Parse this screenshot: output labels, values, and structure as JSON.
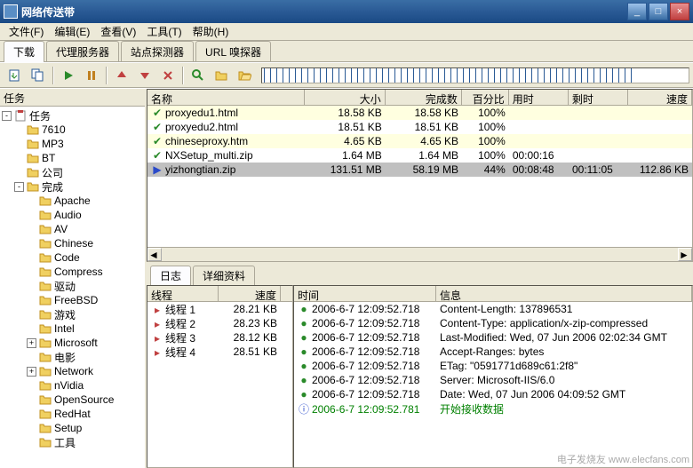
{
  "window": {
    "title": "网络传送带"
  },
  "menu": {
    "file": "文件(F)",
    "edit": "编辑(E)",
    "view": "查看(V)",
    "tools": "工具(T)",
    "help": "帮助(H)"
  },
  "tabs": {
    "download": "下载",
    "proxy": "代理服务器",
    "site_explorer": "站点探测器",
    "url_sniffer": "URL 嗅探器"
  },
  "tree_header": "任务",
  "tree": {
    "root": "任务",
    "items": [
      "7610",
      "MP3",
      "BT",
      "公司"
    ],
    "done": "完成",
    "done_items": [
      "Apache",
      "Audio",
      "AV",
      "Chinese",
      "Code",
      "Compress",
      "驱动",
      "FreeBSD",
      "游戏",
      "Intel",
      "Microsoft",
      "电影",
      "Network",
      "nVidia",
      "OpenSource",
      "RedHat",
      "Setup",
      "工具"
    ]
  },
  "columns": {
    "name": "名称",
    "size": "大小",
    "done": "完成数",
    "percent": "百分比",
    "time": "用时",
    "remain": "剩时",
    "speed": "速度"
  },
  "files": [
    {
      "status": "ok",
      "name": "proxyedu1.html",
      "size": "18.58 KB",
      "done": "18.58 KB",
      "pct": "100%",
      "time": "",
      "remain": "",
      "speed": ""
    },
    {
      "status": "ok",
      "name": "proxyedu2.html",
      "size": "18.51 KB",
      "done": "18.51 KB",
      "pct": "100%",
      "time": "",
      "remain": "",
      "speed": ""
    },
    {
      "status": "ok",
      "name": "chineseproxy.htm",
      "size": "4.65 KB",
      "done": "4.65 KB",
      "pct": "100%",
      "time": "",
      "remain": "",
      "speed": ""
    },
    {
      "status": "ok",
      "name": "NXSetup_multi.zip",
      "size": "1.64 MB",
      "done": "1.64 MB",
      "pct": "100%",
      "time": "00:00:16",
      "remain": "",
      "speed": ""
    },
    {
      "status": "dl",
      "name": "yizhongtian.zip",
      "size": "131.51 MB",
      "done": "58.19 MB",
      "pct": "44%",
      "time": "00:08:48",
      "remain": "00:11:05",
      "speed": "112.86 KB"
    }
  ],
  "log_tabs": {
    "log": "日志",
    "detail": "详细资料"
  },
  "thread_cols": {
    "thread": "线程",
    "speed": "速度"
  },
  "threads": [
    {
      "name": "线程 1",
      "speed": "28.21 KB"
    },
    {
      "name": "线程 2",
      "speed": "28.23 KB"
    },
    {
      "name": "线程 3",
      "speed": "28.12 KB"
    },
    {
      "name": "线程 4",
      "speed": "28.51 KB"
    }
  ],
  "log_cols": {
    "time": "时间",
    "msg": "信息"
  },
  "logs": [
    {
      "icon": "ok",
      "time": "2006-6-7 12:09:52.718",
      "msg": "Content-Length: 137896531"
    },
    {
      "icon": "ok",
      "time": "2006-6-7 12:09:52.718",
      "msg": "Content-Type: application/x-zip-compressed"
    },
    {
      "icon": "ok",
      "time": "2006-6-7 12:09:52.718",
      "msg": "Last-Modified: Wed, 07 Jun 2006 02:02:34 GMT"
    },
    {
      "icon": "ok",
      "time": "2006-6-7 12:09:52.718",
      "msg": "Accept-Ranges: bytes"
    },
    {
      "icon": "ok",
      "time": "2006-6-7 12:09:52.718",
      "msg": "ETag: \"0591771d689c61:2f8\""
    },
    {
      "icon": "ok",
      "time": "2006-6-7 12:09:52.718",
      "msg": "Server: Microsoft-IIS/6.0"
    },
    {
      "icon": "ok",
      "time": "2006-6-7 12:09:52.718",
      "msg": "Date: Wed, 07 Jun 2006 04:09:52 GMT"
    },
    {
      "icon": "info",
      "time": "2006-6-7 12:09:52.781",
      "msg": "开始接收数据"
    }
  ],
  "watermark": "电子发烧友 www.elecfans.com"
}
